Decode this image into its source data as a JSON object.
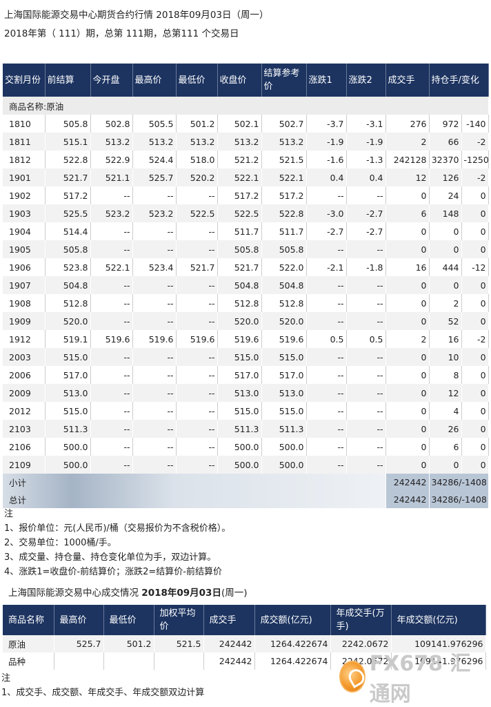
{
  "header": {
    "line1": "上海国际能源交易中心期货合约行情 2018年09月03日（周一）",
    "line2": "2018年第（ 111）期，总第 111期，总第111 个交易日"
  },
  "table1": {
    "columns": [
      "交割月份",
      "前结算",
      "今开盘",
      "最高价",
      "最低价",
      "收盘价",
      "结算参考价",
      "涨跌1",
      "涨跌2",
      "成交手",
      "持仓手/变化"
    ],
    "section": "商品名称:原油",
    "rows": [
      [
        "1810",
        "505.8",
        "502.8",
        "505.5",
        "501.2",
        "502.1",
        "502.7",
        "-3.7",
        "-3.1",
        "276",
        "972",
        "-140"
      ],
      [
        "1811",
        "515.1",
        "513.2",
        "513.2",
        "513.2",
        "513.2",
        "513.2",
        "-1.9",
        "-1.9",
        "2",
        "66",
        "-2"
      ],
      [
        "1812",
        "522.8",
        "522.9",
        "524.4",
        "518.0",
        "521.2",
        "521.5",
        "-1.6",
        "-1.3",
        "242128",
        "32370",
        "-1250"
      ],
      [
        "1901",
        "521.7",
        "521.1",
        "525.7",
        "520.2",
        "522.1",
        "522.1",
        "0.4",
        "0.4",
        "12",
        "126",
        "-2"
      ],
      [
        "1902",
        "517.2",
        "--",
        "--",
        "--",
        "517.2",
        "517.2",
        "--",
        "--",
        "0",
        "24",
        "0"
      ],
      [
        "1903",
        "525.5",
        "523.2",
        "523.2",
        "522.5",
        "522.5",
        "522.8",
        "-3.0",
        "-2.7",
        "6",
        "148",
        "0"
      ],
      [
        "1904",
        "514.4",
        "--",
        "--",
        "--",
        "511.7",
        "511.7",
        "-2.7",
        "-2.7",
        "0",
        "0",
        "0"
      ],
      [
        "1905",
        "505.8",
        "--",
        "--",
        "--",
        "505.8",
        "505.8",
        "--",
        "--",
        "0",
        "0",
        "0"
      ],
      [
        "1906",
        "523.8",
        "522.1",
        "523.4",
        "521.7",
        "521.7",
        "522.0",
        "-2.1",
        "-1.8",
        "16",
        "444",
        "-12"
      ],
      [
        "1907",
        "504.8",
        "--",
        "--",
        "--",
        "504.8",
        "504.8",
        "--",
        "--",
        "0",
        "0",
        "0"
      ],
      [
        "1908",
        "512.8",
        "--",
        "--",
        "--",
        "512.8",
        "512.8",
        "--",
        "--",
        "0",
        "2",
        "0"
      ],
      [
        "1909",
        "520.0",
        "--",
        "--",
        "--",
        "520.0",
        "520.0",
        "--",
        "--",
        "0",
        "52",
        "0"
      ],
      [
        "1912",
        "519.1",
        "519.6",
        "519.6",
        "519.6",
        "519.6",
        "519.6",
        "0.5",
        "0.5",
        "2",
        "16",
        "-2"
      ],
      [
        "2003",
        "515.0",
        "--",
        "--",
        "--",
        "515.0",
        "515.0",
        "--",
        "--",
        "0",
        "10",
        "0"
      ],
      [
        "2006",
        "517.0",
        "--",
        "--",
        "--",
        "517.0",
        "517.0",
        "--",
        "--",
        "0",
        "8",
        "0"
      ],
      [
        "2009",
        "513.0",
        "--",
        "--",
        "--",
        "513.0",
        "513.0",
        "--",
        "--",
        "0",
        "12",
        "0"
      ],
      [
        "2012",
        "515.0",
        "--",
        "--",
        "--",
        "515.0",
        "515.0",
        "--",
        "--",
        "0",
        "4",
        "0"
      ],
      [
        "2103",
        "511.3",
        "--",
        "--",
        "--",
        "511.3",
        "511.3",
        "--",
        "--",
        "0",
        "26",
        "0"
      ],
      [
        "2106",
        "500.0",
        "--",
        "--",
        "--",
        "500.0",
        "500.0",
        "--",
        "--",
        "0",
        "6",
        "0"
      ],
      [
        "2109",
        "500.0",
        "--",
        "--",
        "--",
        "500.0",
        "500.0",
        "--",
        "--",
        "0",
        "0",
        "0"
      ]
    ],
    "subtotal": {
      "label": "小计",
      "volume": "242442",
      "oi": "34286/-1408"
    },
    "total": {
      "label": "总计",
      "volume": "242442",
      "oi": "34286/-1408"
    }
  },
  "notes1": [
    "注",
    "1、报价单位：元(人民币)/桶（交易报价为不含税价格）。",
    "2、交易单位：1000桶/手。",
    "3、成交量、持仓量、持仓变化单位为手，双边计算。",
    "4、涨跌1=收盘价-前结算价；涨跌2=结算价-前结算价"
  ],
  "summary_title": {
    "prefix": "上海国际能源交易中心成交情况 ",
    "date": "2018年09月03日",
    "suffix": "(周一)"
  },
  "table2": {
    "columns": [
      "商品名称",
      "最高价",
      "最低价",
      "加权平均价",
      "成交手",
      "成交额(亿元)",
      "年成交手(万手)",
      "年成交额(亿元)"
    ],
    "rows": [
      [
        "原油",
        "525.7",
        "501.2",
        "521.5",
        "242442",
        "1264.422674",
        "2242.0672",
        "109141.976296"
      ],
      [
        "品种",
        "",
        "",
        "",
        "242442",
        "1264.422674",
        "2242.0672",
        "109141.976296"
      ]
    ]
  },
  "notes2": [
    "注",
    "1、成交手、成交额、年成交手、年成交额双边计算"
  ],
  "watermark": {
    "text": "FX678 汇通网"
  }
}
